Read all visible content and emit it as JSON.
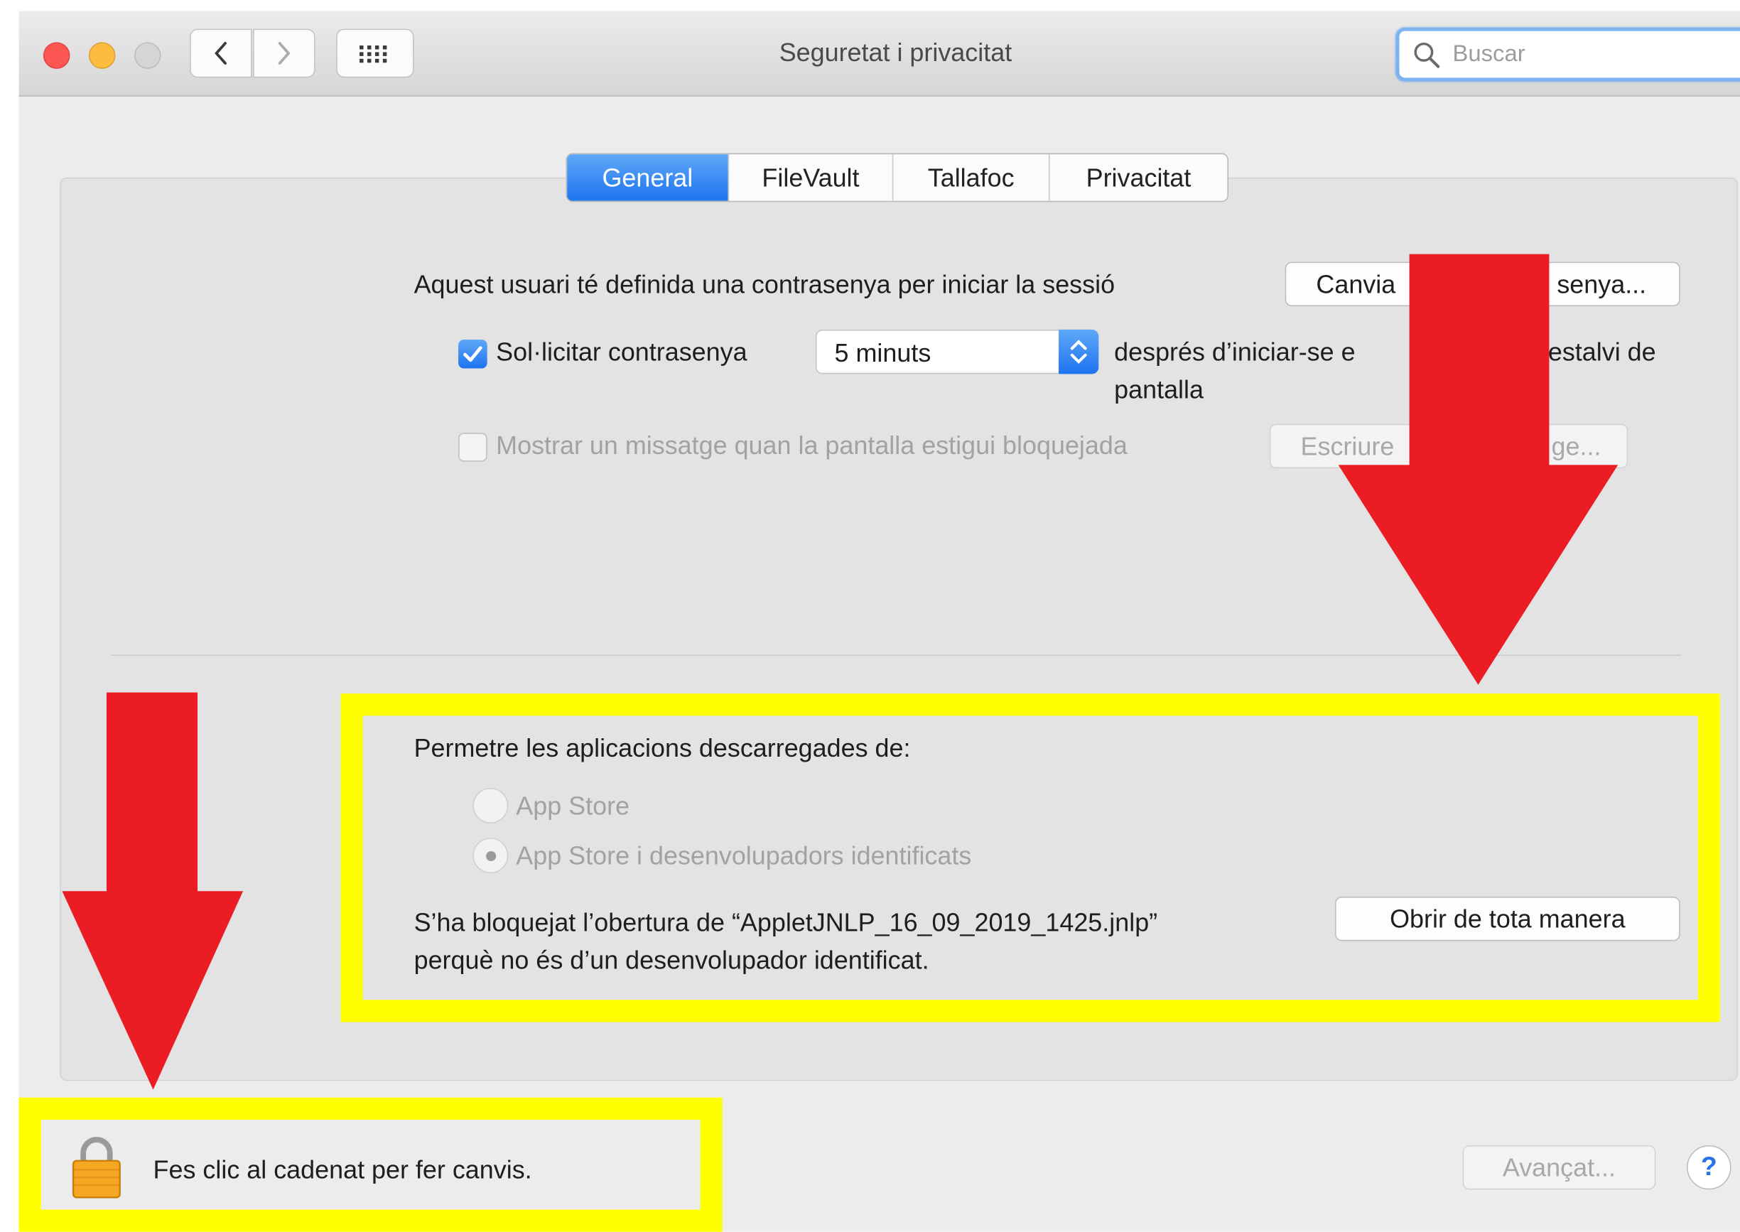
{
  "window": {
    "title": "Seguretat i privacitat"
  },
  "search": {
    "placeholder": "Buscar"
  },
  "tabs": [
    {
      "label": "General",
      "active": true
    },
    {
      "label": "FileVault",
      "active": false
    },
    {
      "label": "Tallafoc",
      "active": false
    },
    {
      "label": "Privacitat",
      "active": false
    }
  ],
  "password": {
    "text": "Aquest usuari té definida una contrasenya per iniciar la sessió",
    "change_button_visible": "Canvia",
    "change_button_visible_tail": "senya..."
  },
  "require_password": {
    "checked": true,
    "label": "Sol·licitar contrasenya",
    "select_value": "5 minuts",
    "after_text_visible_1": "després d’iniciar-se e",
    "after_text_visible_2": "estalvi de",
    "after_text_line2": "pantalla"
  },
  "lock_message": {
    "checked": false,
    "label": "Mostrar un missatge quan la pantalla estigui bloquejada",
    "button_visible_head": "Escriure",
    "button_visible_tail": "ge..."
  },
  "downloads": {
    "heading": "Permetre les aplicacions descarregades de:",
    "options": [
      {
        "label": "App Store",
        "selected": false
      },
      {
        "label": "App Store i desenvolupadors identificats",
        "selected": true
      }
    ],
    "blocked_line1": "S’ha bloquejat l’obertura de “AppletJNLP_16_09_2019_1425.jnlp”",
    "blocked_line2": "perquè no és d’un desenvolupador identificat.",
    "open_anyway_button": "Obrir de tota manera"
  },
  "footer": {
    "lock_text": "Fes clic al cadenat per fer canvis.",
    "advanced_button": "Avançat...",
    "help_button": "?"
  },
  "colors": {
    "annotation_arrow": "#ec1c24",
    "annotation_highlight": "#ffff00",
    "accent": "#1e73f0"
  }
}
